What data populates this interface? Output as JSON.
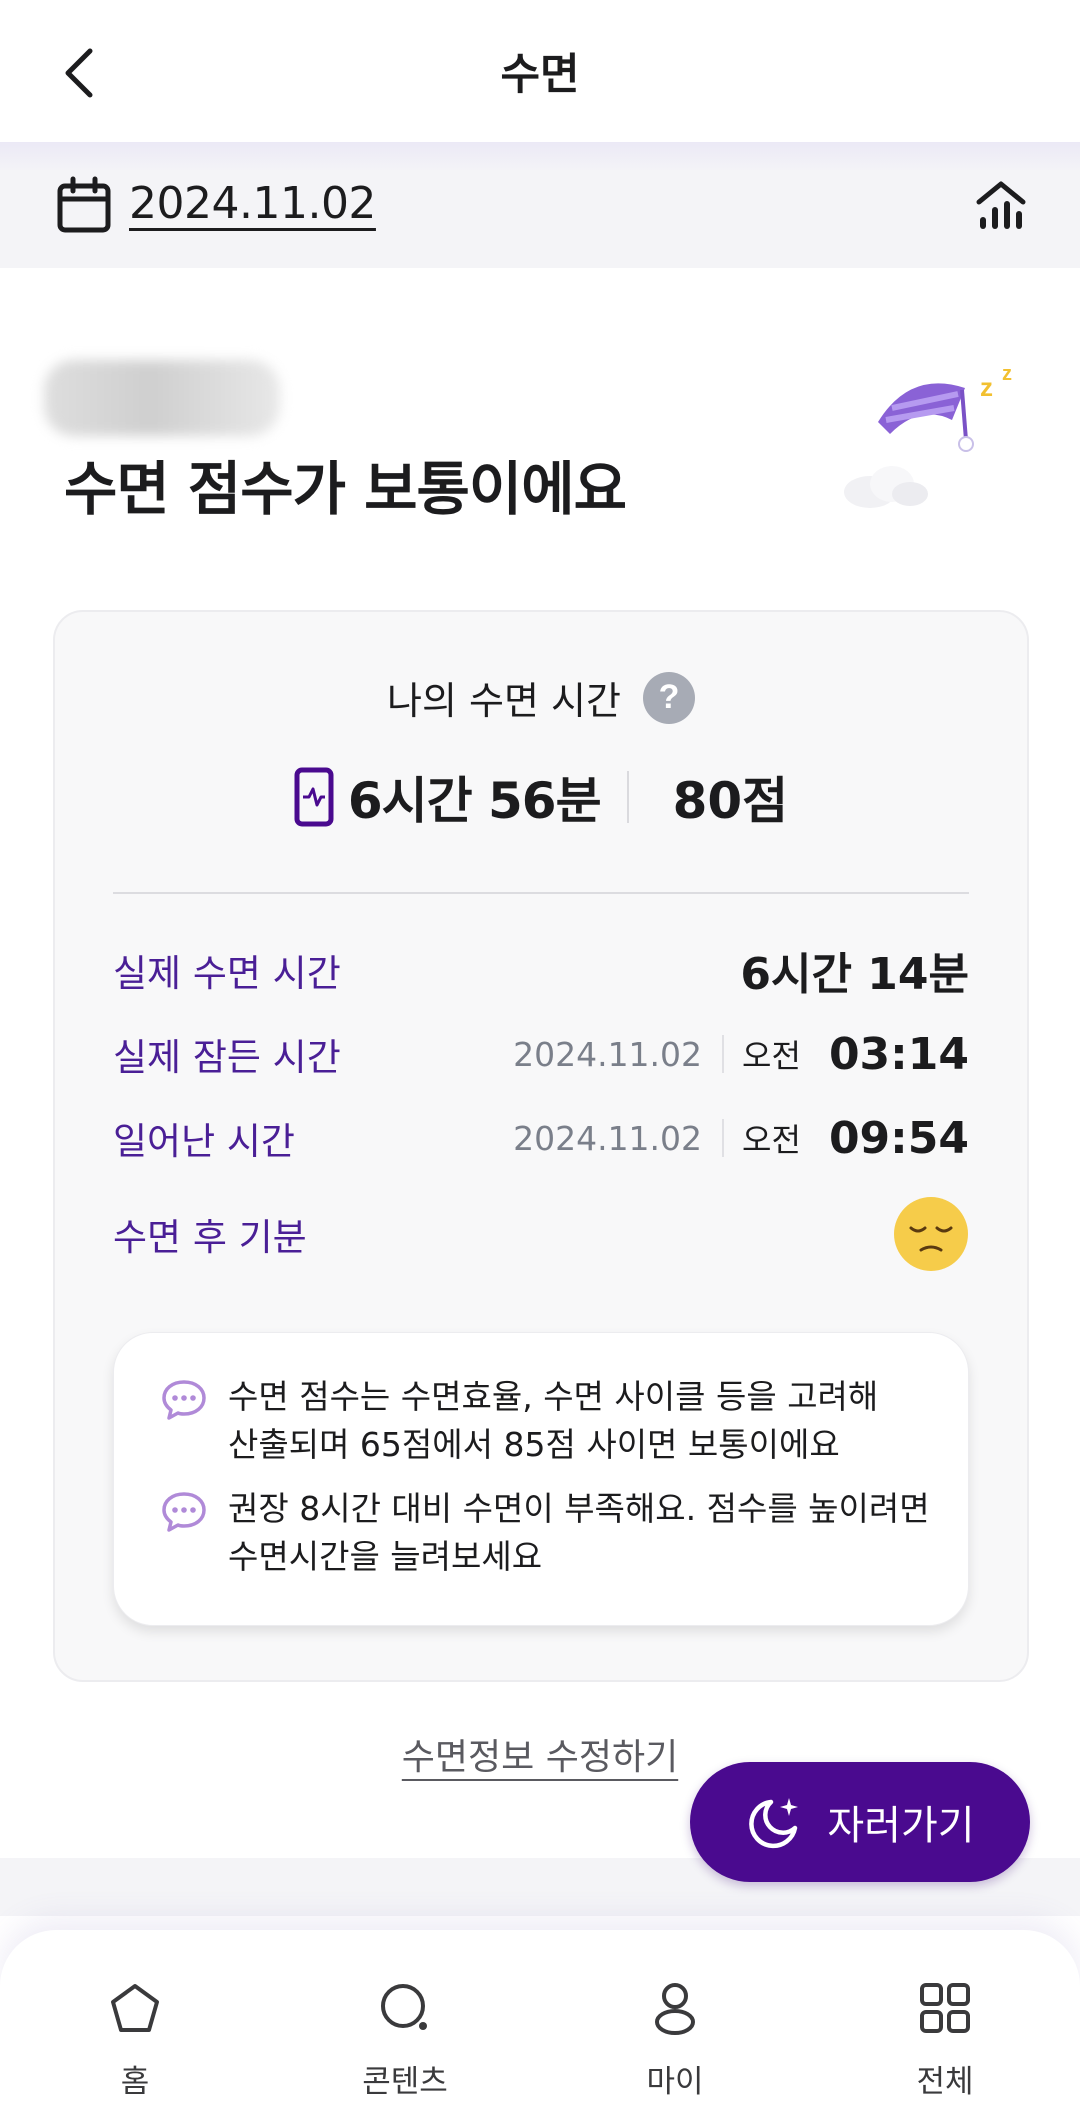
{
  "header": {
    "title": "수면",
    "back_icon": "chevron-left-icon"
  },
  "date_bar": {
    "date": "2024.11.02",
    "calendar_icon": "calendar-icon",
    "stats_icon": "bar-chart-icon"
  },
  "headline": {
    "message": "수면 점수가 보통이에요"
  },
  "card": {
    "title": "나의 수면 시간",
    "help_symbol": "?",
    "total_time": "6시간 56분",
    "score": "80점",
    "details": {
      "actual_sleep": {
        "label": "실제 수면 시간",
        "value": "6시간 14분"
      },
      "fell_asleep": {
        "label": "실제 잠든 시간",
        "date": "2024.11.02",
        "ampm": "오전",
        "time": "03:14"
      },
      "woke_up": {
        "label": "일어난 시간",
        "date": "2024.11.02",
        "ampm": "오전",
        "time": "09:54"
      },
      "mood": {
        "label": "수면 후 기분",
        "icon": "sleepy-face-icon"
      }
    },
    "notes": [
      {
        "line1": "수면 점수는 수면효율, 수면 사이클 등을 고려해",
        "line2": "산출되며 65점에서 85점 사이면 보통이에요"
      },
      {
        "line1": "권장 8시간 대비 수면이 부족해요. 점수를 높이려면",
        "line2": "수면시간을 늘려보세요"
      }
    ]
  },
  "edit_link": "수면정보 수정하기",
  "sleep_button": {
    "label": "자러가기",
    "icon": "moon-sparkle-icon"
  },
  "colors": {
    "accent_purple": "#4a0a8f",
    "label_purple": "#4a1f96",
    "mood_yellow": "#f6cc4a"
  },
  "bottom_nav": {
    "items": [
      {
        "label": "홈",
        "icon": "home-icon"
      },
      {
        "label": "콘텐츠",
        "icon": "search-content-icon"
      },
      {
        "label": "마이",
        "icon": "person-icon"
      },
      {
        "label": "전체",
        "icon": "grid-icon"
      }
    ]
  }
}
